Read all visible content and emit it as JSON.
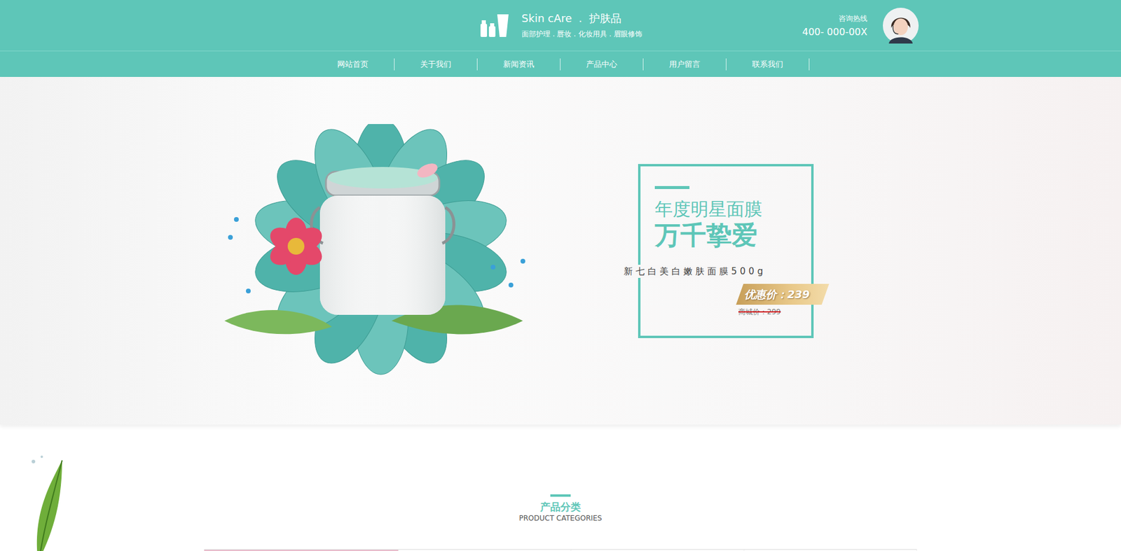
{
  "header": {
    "brand": "Skin cAre  .  护肤品",
    "tagline": "面部护理 . 唇妆 . 化妆用具 . 眉眼修饰",
    "hotline_label": "咨询热线",
    "hotline_number": "400- 000-00X"
  },
  "nav": [
    {
      "label": "网站首页"
    },
    {
      "label": "关于我们"
    },
    {
      "label": "新闻资讯"
    },
    {
      "label": "产品中心"
    },
    {
      "label": "用户留言"
    },
    {
      "label": "联系我们"
    }
  ],
  "banner": {
    "subtitle": "年度明星面膜",
    "title": "万千挚爱",
    "product": "新七白美白嫩肤面膜500g",
    "sale_price": "优惠价：239",
    "market_price": "商城价：299"
  },
  "section": {
    "title": "产品分类",
    "subtitle": "PRODUCT CATEGORIES"
  },
  "category_tabs": [
    {
      "selected": true
    },
    {
      "selected": false
    },
    {
      "selected": false
    },
    {
      "selected": false
    }
  ]
}
